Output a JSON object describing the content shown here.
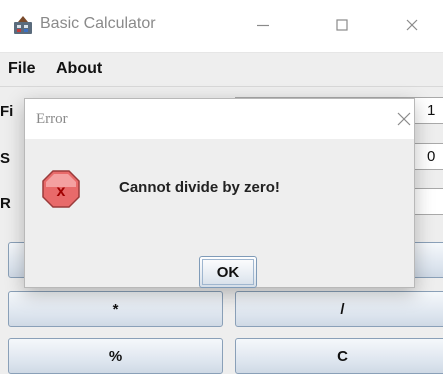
{
  "window": {
    "title": "Basic Calculator",
    "icon": "calculator-app-icon",
    "controls": {
      "minimize": "—",
      "maximize": "☐",
      "close": "✕"
    }
  },
  "menu": {
    "items": [
      "File",
      "About"
    ]
  },
  "form": {
    "first_label": "Fi",
    "second_label": "S",
    "result_label": "R",
    "first_value": "1",
    "second_value": "0"
  },
  "buttons": {
    "multiply": "*",
    "divide": "/",
    "modulo": "%",
    "clear": "C"
  },
  "dialog": {
    "title": "Error",
    "message": "Cannot divide by zero!",
    "ok_label": "OK",
    "close_glyph": "✕",
    "icon": "error-icon",
    "colors": {
      "icon_fill": "#e86a6a",
      "icon_x": "#b00000"
    }
  }
}
